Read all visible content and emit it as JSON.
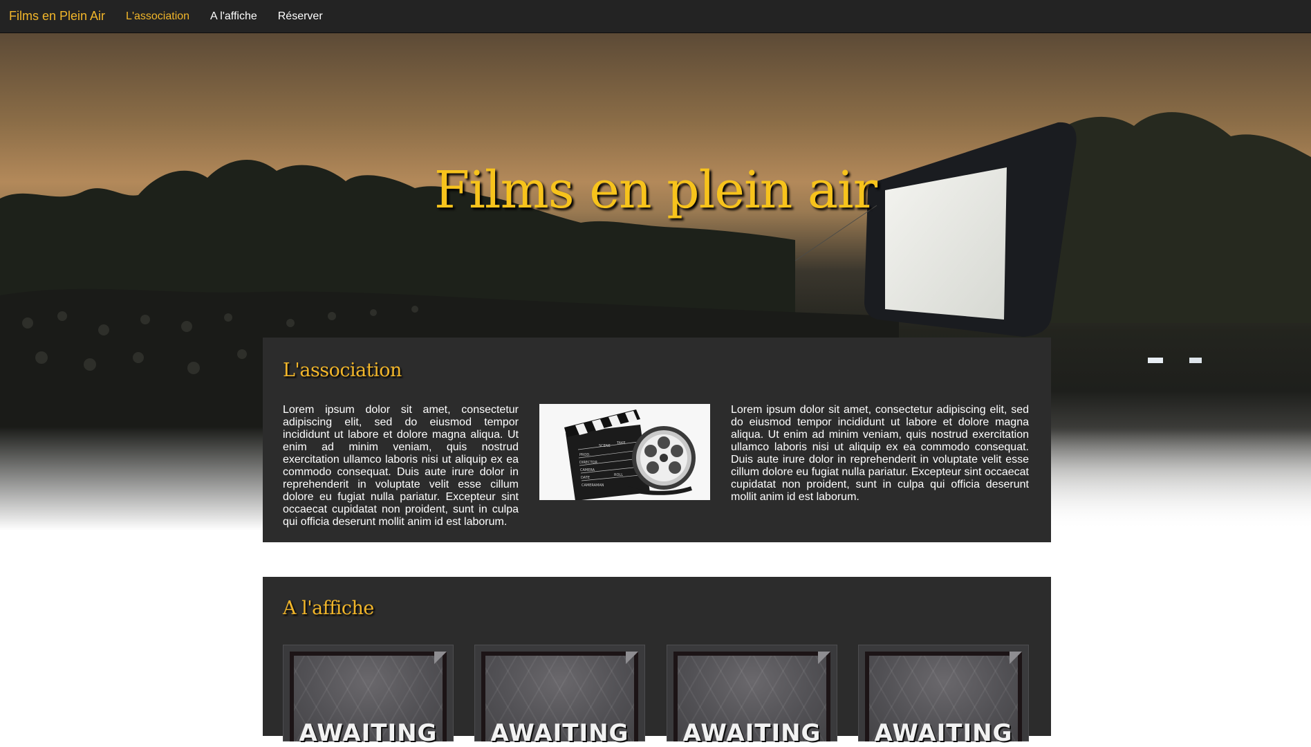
{
  "nav": {
    "brand": "Films en Plein Air",
    "items": [
      {
        "label": "L'association",
        "active": true
      },
      {
        "label": "A l'affiche",
        "active": false
      },
      {
        "label": "Réserver",
        "active": false
      }
    ]
  },
  "hero": {
    "title": "Films en plein air"
  },
  "association": {
    "title": "L'association",
    "text_left": "Lorem ipsum dolor sit amet, consectetur adipiscing elit, sed do eiusmod tempor incididunt ut labore et dolore magna aliqua. Ut enim ad minim veniam, quis nostrud exercitation ullamco laboris nisi ut aliquip ex ea commodo consequat. Duis aute irure dolor in reprehenderit in voluptate velit esse cillum dolore eu fugiat nulla pariatur. Excepteur sint occaecat cupidatat non proident, sunt in culpa qui officia deserunt mollit anim id est laborum.",
    "image_label": "clapperboard-film-reel-image",
    "clapper_labels": [
      "SCENE",
      "TAKE",
      "ROLL",
      "PROD.",
      "DIRECTOR",
      "CAMERA",
      "DATE",
      "CAMERAMAN"
    ],
    "text_right": "Lorem ipsum dolor sit amet, consectetur adipiscing elit, sed do eiusmod tempor incididunt ut labore et dolore magna aliqua. Ut enim ad minim veniam, quis nostrud exercitation ullamco laboris nisi ut aliquip ex ea commodo consequat. Duis aute irure dolor in reprehenderit in voluptate velit esse cillum dolore eu fugiat nulla pariatur. Excepteur sint occaecat cupidatat non proident, sunt in culpa qui officia deserunt mollit anim id est laborum."
  },
  "affiche": {
    "title": "A l'affiche",
    "posters": [
      {
        "label": "AWAITING"
      },
      {
        "label": "AWAITING"
      },
      {
        "label": "AWAITING"
      },
      {
        "label": "AWAITING"
      }
    ]
  },
  "colors": {
    "accent": "#f2b62a",
    "navbar": "#232323",
    "section_bg": "#2c2c2c"
  }
}
